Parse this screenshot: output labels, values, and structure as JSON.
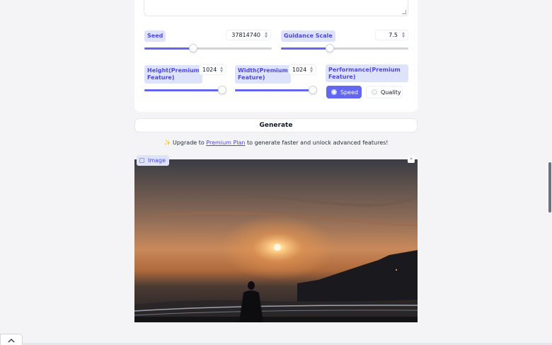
{
  "settings": {
    "seed": {
      "label": "Seed",
      "value": "37814740",
      "slider_fraction": 0.38
    },
    "guidance": {
      "label": "Guidance Scale",
      "value": "7.5",
      "slider_fraction": 0.38
    },
    "height": {
      "label_line1": "Height(Premium",
      "label_line2": "Feature)",
      "value": "1024",
      "slider_fraction": 0.95
    },
    "width": {
      "label_line1": "Width(Premium",
      "label_line2": "Feature)",
      "value": "1024",
      "slider_fraction": 0.95
    },
    "performance": {
      "label_line1": "Performance(Premium",
      "label_line2": "Feature)",
      "options": [
        "Speed",
        "Quality"
      ],
      "selected": "Speed"
    }
  },
  "generate_label": "Generate",
  "upgrade": {
    "sparkle": "✨",
    "prefix": "Upgrade to",
    "link": "Premium Plan",
    "suffix": "to generate faster and unlock advanced features!"
  },
  "output": {
    "label": "Image",
    "close_glyph": "×"
  },
  "colors": {
    "accent": "#6366f1",
    "chip_bg": "#dde3fb",
    "chip_text": "#4f46e5"
  },
  "icons": [
    "image-icon",
    "close-icon",
    "chevron-up-icon",
    "sparkle-icon",
    "spinner-icon"
  ]
}
